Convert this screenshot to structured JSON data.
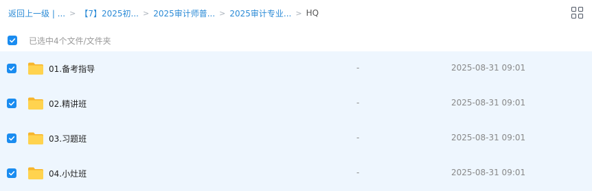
{
  "breadcrumb": {
    "back": "返回上一级 | ...",
    "items": [
      "【7】2025初...",
      "2025审计师普...",
      "2025审计专业..."
    ],
    "current": "HQ",
    "separator": ">"
  },
  "toolbar": {
    "view_toggle_icon": "grid-view-icon"
  },
  "selection": {
    "summary": "已选中4个文件/文件夹",
    "all_checked": true
  },
  "files": [
    {
      "name": "01.备考指导",
      "size": "-",
      "modified": "2025-08-31 09:01",
      "checked": true
    },
    {
      "name": "02.精讲班",
      "size": "-",
      "modified": "2025-08-31 09:01",
      "checked": true
    },
    {
      "name": "03.习题班",
      "size": "-",
      "modified": "2025-08-31 09:01",
      "checked": true
    },
    {
      "name": "04.小灶班",
      "size": "-",
      "modified": "2025-08-31 09:01",
      "checked": true
    }
  ],
  "colors": {
    "accent": "#1a8cf0",
    "link": "#2a8ad6",
    "selected_bg": "#eef6fe",
    "folder": "#ffc83d"
  }
}
